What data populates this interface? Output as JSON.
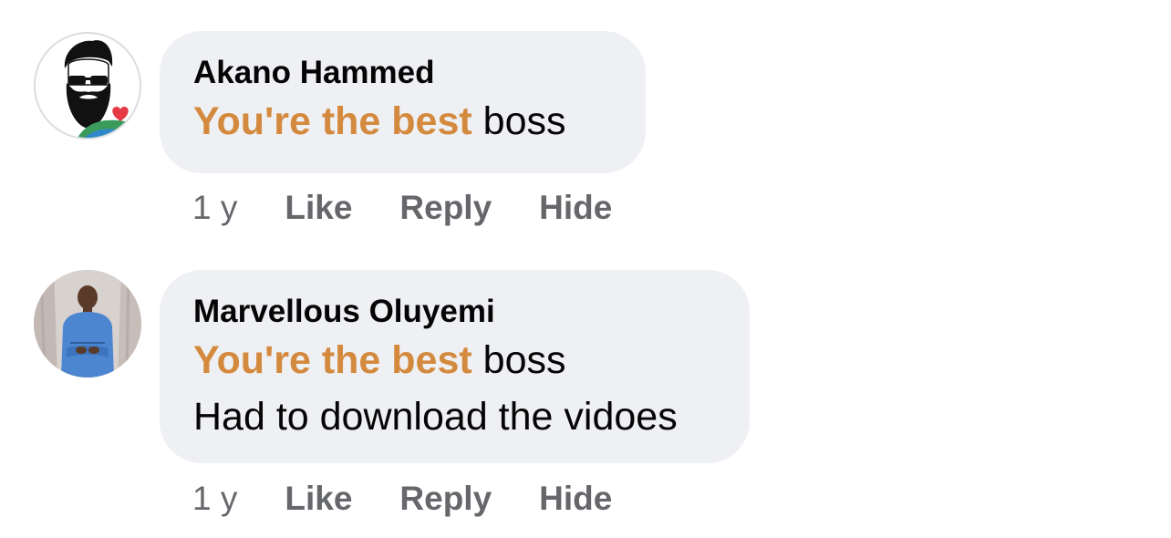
{
  "comments": [
    {
      "author": "Akano Hammed",
      "mention": "You're the best",
      "text_after_mention": " boss",
      "extra_line": "",
      "time": "1 y",
      "like_label": "Like",
      "reply_label": "Reply",
      "hide_label": "Hide",
      "avatar_icon": "bearded-man-sunglasses-avatar"
    },
    {
      "author": "Marvellous Oluyemi",
      "mention": "You're the best",
      "text_after_mention": " boss",
      "extra_line": "Had to download the vidoes",
      "time": "1 y",
      "like_label": "Like",
      "reply_label": "Reply",
      "hide_label": "Hide",
      "avatar_icon": "man-blue-outfit-photo-avatar"
    }
  ],
  "colors": {
    "bubble": "#eff0f3",
    "mention": "#d48a3e",
    "meta": "#65676b",
    "text": "#050505"
  }
}
